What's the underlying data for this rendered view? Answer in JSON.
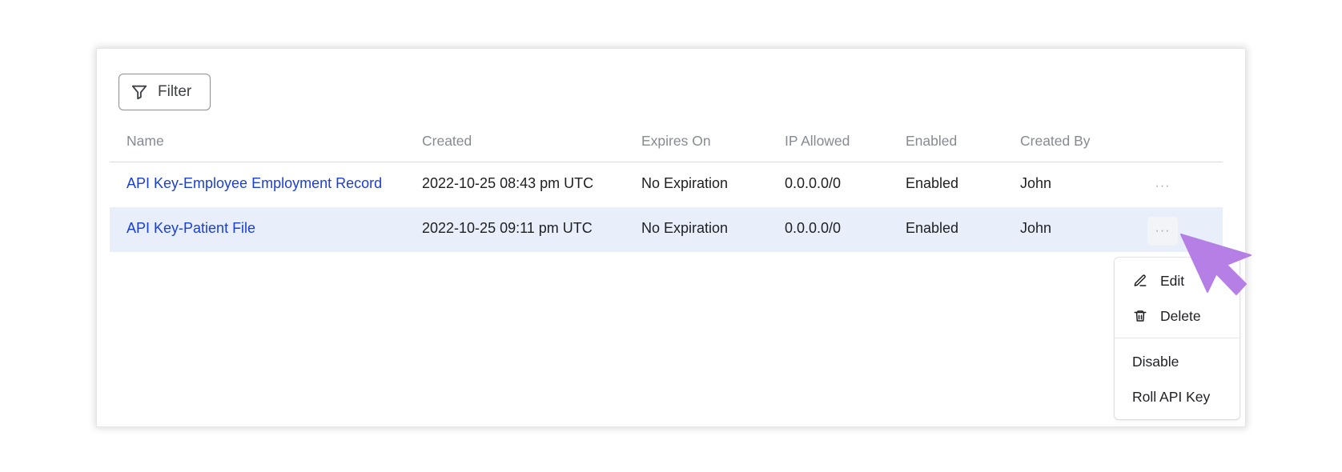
{
  "toolbar": {
    "filter_label": "Filter",
    "filter_icon": "funnel-icon"
  },
  "table": {
    "columns": [
      "Name",
      "Created",
      "Expires On",
      "IP Allowed",
      "Enabled",
      "Created By"
    ],
    "rows": [
      {
        "name": "API Key-Employee Employment Record",
        "created": "2022-10-25 08:43 pm UTC",
        "expires": "No Expiration",
        "ip": "0.0.0.0/0",
        "enabled": "Enabled",
        "created_by": "John",
        "more": "···"
      },
      {
        "name": "API Key-Patient File",
        "created": "2022-10-25 09:11 pm UTC",
        "expires": "No Expiration",
        "ip": "0.0.0.0/0",
        "enabled": "Enabled",
        "created_by": "John",
        "more": "···"
      }
    ]
  },
  "context_menu": {
    "items": [
      {
        "label": "Edit",
        "icon": "pencil-icon"
      },
      {
        "label": "Delete",
        "icon": "trash-icon"
      },
      {
        "label": "Disable"
      },
      {
        "label": "Roll API Key"
      }
    ]
  },
  "colors": {
    "link": "#1a3edb",
    "selected_row": "#e8effa",
    "header_text": "#868a92",
    "cursor": "#b57fe6"
  }
}
